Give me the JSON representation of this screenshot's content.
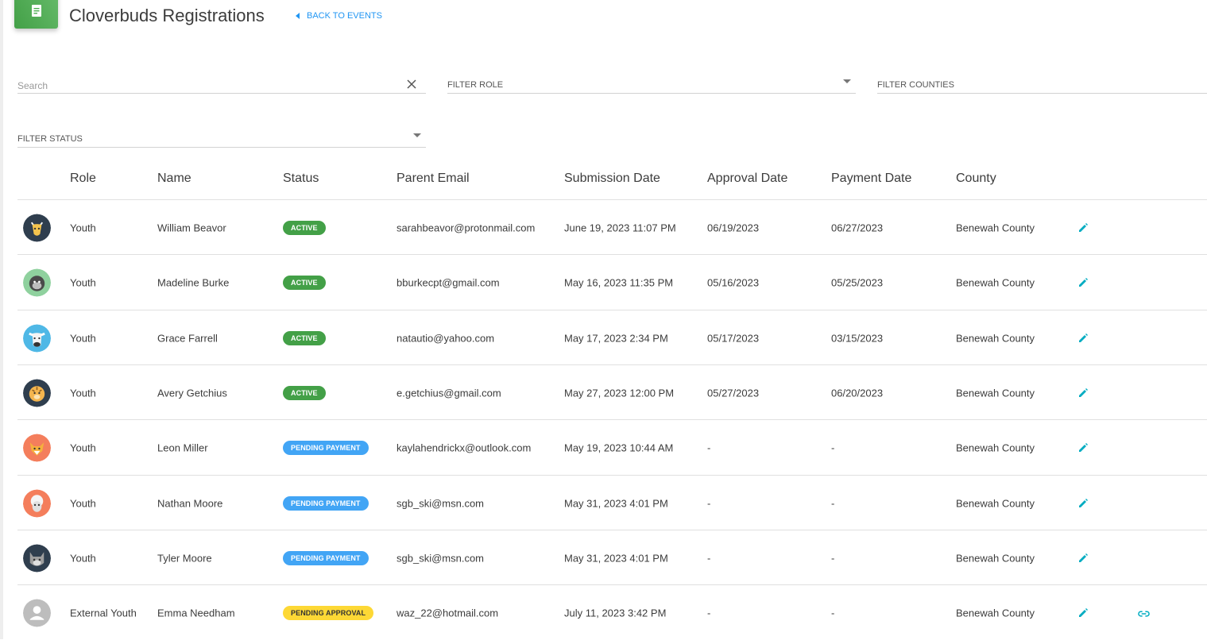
{
  "header": {
    "title": "Cloverbuds Registrations",
    "back_label": "BACK TO EVENTS",
    "icon": "clipboard-icon",
    "accent": "#4caf50"
  },
  "filters": {
    "search_placeholder": "Search",
    "search_value": "",
    "role_label": "FILTER ROLE",
    "counties_label": "FILTER COUNTIES",
    "status_label": "FILTER STATUS"
  },
  "table": {
    "columns": [
      "Role",
      "Name",
      "Status",
      "Parent Email",
      "Submission Date",
      "Approval Date",
      "Payment Date",
      "County"
    ],
    "rows": [
      {
        "avatar": "goat",
        "role": "Youth",
        "name": "William Beavor",
        "status": "ACTIVE",
        "status_type": "active",
        "email": "sarahbeavor@protonmail.com",
        "submission": "June 19, 2023 11:07 PM",
        "approval": "06/19/2023",
        "payment": "06/27/2023",
        "county": "Benewah County",
        "link": false
      },
      {
        "avatar": "monkey",
        "role": "Youth",
        "name": "Madeline Burke",
        "status": "ACTIVE",
        "status_type": "active",
        "email": "bburkecpt@gmail.com",
        "submission": "May 16, 2023 11:35 PM",
        "approval": "05/16/2023",
        "payment": "05/25/2023",
        "county": "Benewah County",
        "link": false
      },
      {
        "avatar": "cow",
        "role": "Youth",
        "name": "Grace Farrell",
        "status": "ACTIVE",
        "status_type": "active",
        "email": "natautio@yahoo.com",
        "submission": "May 17, 2023 2:34 PM",
        "approval": "05/17/2023",
        "payment": "03/15/2023",
        "county": "Benewah County",
        "link": false
      },
      {
        "avatar": "tiger",
        "role": "Youth",
        "name": "Avery Getchius",
        "status": "ACTIVE",
        "status_type": "active",
        "email": "e.getchius@gmail.com",
        "submission": "May 27, 2023 12:00 PM",
        "approval": "05/27/2023",
        "payment": "06/20/2023",
        "county": "Benewah County",
        "link": false
      },
      {
        "avatar": "fox",
        "role": "Youth",
        "name": "Leon Miller",
        "status": "PENDING PAYMENT",
        "status_type": "payment",
        "email": "kaylahendrickx@outlook.com",
        "submission": "May 19, 2023 10:44 AM",
        "approval": "-",
        "payment": "-",
        "county": "Benewah County",
        "link": false
      },
      {
        "avatar": "sheep",
        "role": "Youth",
        "name": "Nathan Moore",
        "status": "PENDING PAYMENT",
        "status_type": "payment",
        "email": "sgb_ski@msn.com",
        "submission": "May 31, 2023 4:01 PM",
        "approval": "-",
        "payment": "-",
        "county": "Benewah County",
        "link": false
      },
      {
        "avatar": "cat",
        "role": "Youth",
        "name": "Tyler Moore",
        "status": "PENDING PAYMENT",
        "status_type": "payment",
        "email": "sgb_ski@msn.com",
        "submission": "May 31, 2023 4:01 PM",
        "approval": "-",
        "payment": "-",
        "county": "Benewah County",
        "link": false
      },
      {
        "avatar": "person",
        "role": "External Youth",
        "name": "Emma Needham",
        "status": "PENDING APPROVAL",
        "status_type": "approval",
        "email": "waz_22@hotmail.com",
        "submission": "July 11, 2023 3:42 PM",
        "approval": "-",
        "payment": "-",
        "county": "Benewah County",
        "link": true
      }
    ]
  },
  "colors": {
    "active": "#43a047",
    "pending_payment": "#42a5f5",
    "pending_approval": "#fdd835",
    "edit_icon": "#00acc1"
  }
}
